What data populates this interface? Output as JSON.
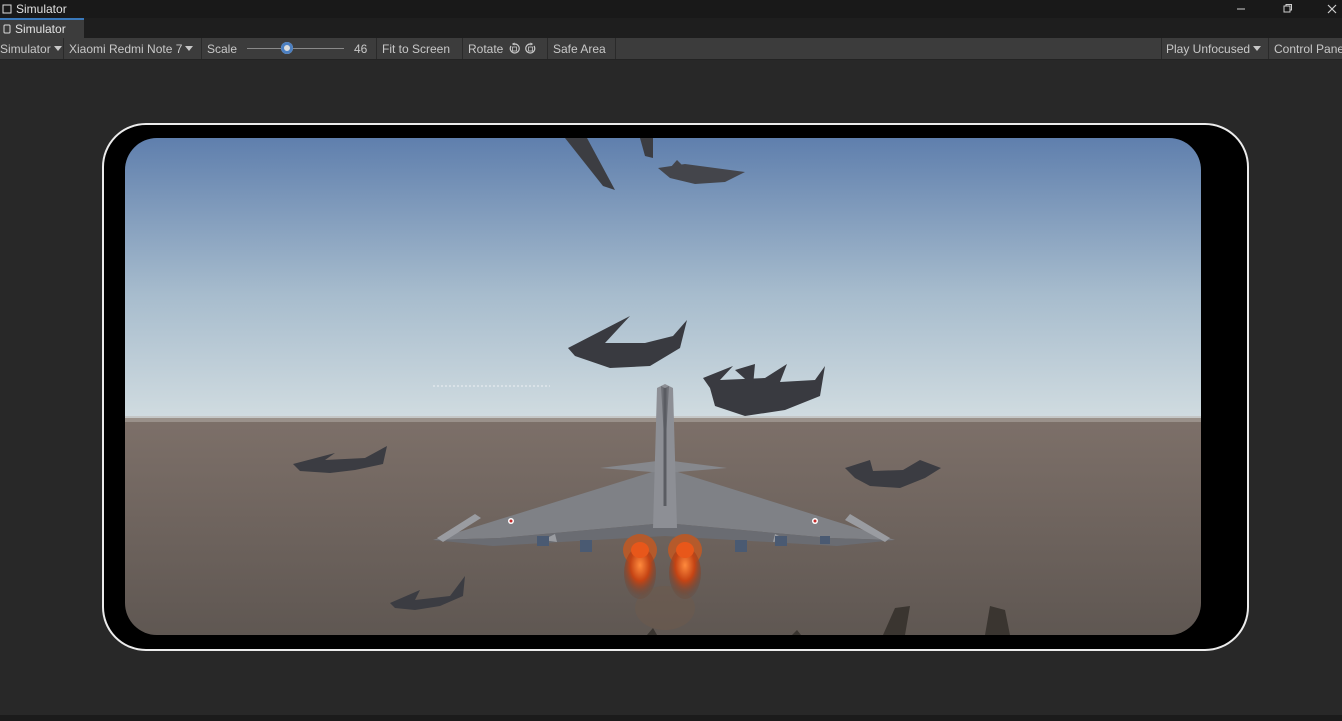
{
  "window": {
    "title": "Simulator",
    "icon": "simulator-icon",
    "controls": [
      "minimize-icon",
      "maximize-icon",
      "close-icon"
    ]
  },
  "tabs": [
    {
      "label": "Simulator",
      "icon": "device-icon",
      "active": true
    }
  ],
  "toolbar": {
    "mode_dropdown": "Simulator",
    "device_dropdown": "Xiaomi Redmi Note 7",
    "scale_label": "Scale",
    "scale_value": "46",
    "fit_to_screen": "Fit to Screen",
    "rotate_label": "Rotate",
    "rotate_icons": [
      "rotate-left-icon",
      "rotate-right-icon"
    ],
    "safe_area": "Safe Area",
    "play_mode_dropdown": "Play Unfocused",
    "control_panel": "Control Panel"
  },
  "colors": {
    "title_bar": "#191919",
    "toolbar": "#3c3c3c",
    "viewport_bg": "#282828",
    "accent": "#3a79bb",
    "device_frame": "#ececec",
    "sky_top": "#5f80ae",
    "sky_horizon": "#d0dbe0",
    "ground": "#6c625b"
  },
  "game_view": {
    "scene": "fighter-jet-formation-flight",
    "player_aircraft": "twin-engine-delta-wing-fighter",
    "afterburner_color": "#e8571a"
  }
}
